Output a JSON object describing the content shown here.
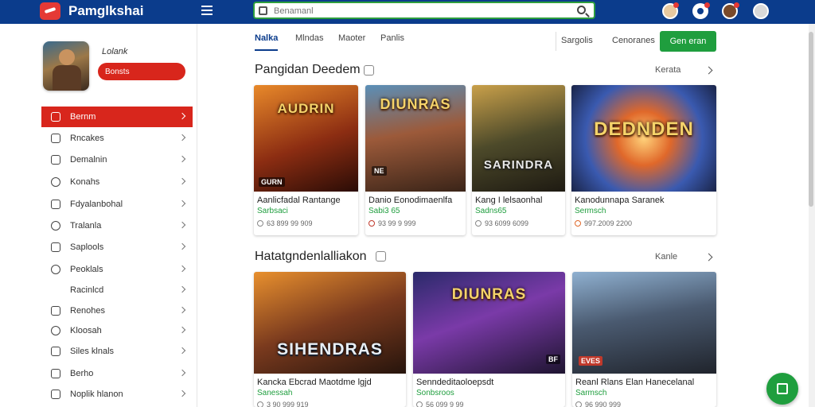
{
  "app": {
    "title": "Pamglkshai"
  },
  "header": {
    "search_placeholder": "Benamanl"
  },
  "profile": {
    "name": "Lolank",
    "button_label": "Bonsts"
  },
  "sidebar": {
    "items": [
      {
        "label": "Bernm",
        "icon": "bag-icon",
        "active": true
      },
      {
        "label": "Rncakes",
        "icon": "box-icon"
      },
      {
        "label": "Demalnin",
        "icon": "book-icon"
      },
      {
        "label": "Konahs",
        "icon": "circle-icon"
      },
      {
        "label": "Fdyalanbohal",
        "icon": "rocket-icon"
      },
      {
        "label": "Tralanla",
        "icon": "search-icon"
      },
      {
        "label": "Saplools",
        "icon": "gift-icon"
      },
      {
        "label": "Peoklals",
        "icon": "clock-icon"
      },
      {
        "label": "Racinlcd",
        "icon": "none"
      },
      {
        "label": "Renohes",
        "icon": "grid-icon"
      },
      {
        "label": "Kloosah",
        "icon": "target-icon"
      },
      {
        "label": "Siles klnals",
        "icon": "shield-icon"
      },
      {
        "label": "Berho",
        "icon": "store-icon"
      },
      {
        "label": "Noplik hlanon",
        "icon": "shield-icon"
      }
    ]
  },
  "tabs": [
    {
      "label": "Nalka",
      "active": true
    },
    {
      "label": "Mlndas"
    },
    {
      "label": "Maoter"
    },
    {
      "label": "Panlis"
    }
  ],
  "top_links": {
    "link1": "Sargolis",
    "link2": "Cenoranes",
    "cta": "Gen eran"
  },
  "section1": {
    "title": "Pangidan Deedem",
    "more": "Kerata",
    "cards": [
      {
        "art_title": "AUDRIN",
        "badge": "GURN",
        "title": "Aanlicfadal Rantange",
        "price": "Sarbsaci",
        "meta": "63 899 99 909"
      },
      {
        "art_title": "DIUNRAS",
        "badge": "NE",
        "title": "Danio Eonodimaenlfa",
        "price": "Sabi3 65",
        "meta": "93 99 9 999"
      },
      {
        "art_title": "SARINDRA",
        "badge": "",
        "title": "Kang I lelsaonhal",
        "price": "Sadns65",
        "meta": "93 6099 6099"
      },
      {
        "art_title": "DEDNDEN",
        "badge": "",
        "title": "Kanodunnapa Saranek",
        "price": "Sermsch",
        "meta": "997.2009 2200"
      }
    ]
  },
  "section2": {
    "title": "Hatatgndenlalliakon",
    "more": "Kanle",
    "cards": [
      {
        "art_title": "SIHENDRAS",
        "badge": "",
        "title": "Kancka Ebcrad Maotdme lgjd",
        "price": "Sanessah",
        "meta": "3 90 999 919"
      },
      {
        "art_title": "DIUNRAS",
        "badge": "BF",
        "title": "Senndeditaoloepsdt",
        "price": "Sonbsroos",
        "meta": "56 099 9 99"
      },
      {
        "art_title": "",
        "badge": "EVES",
        "title": "Reanl Rlans Elan Hanecelanal",
        "price": "Sarmsch",
        "meta": "96 990 999"
      }
    ]
  }
}
